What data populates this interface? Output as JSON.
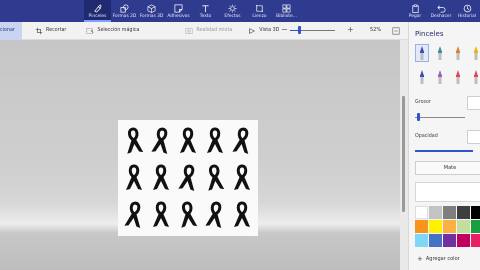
{
  "ribbon": {
    "tools": [
      {
        "name": "pinceles",
        "label": "Pinceles",
        "icon": "brush-icon",
        "active": true
      },
      {
        "name": "formas-2d",
        "label": "Formas 2D",
        "icon": "shapes-2d-icon"
      },
      {
        "name": "formas-3d",
        "label": "Formas 3D",
        "icon": "shapes-3d-icon"
      },
      {
        "name": "adhesivos",
        "label": "Adhesivos",
        "icon": "sticker-icon"
      },
      {
        "name": "texto",
        "label": "Texto",
        "icon": "text-icon"
      },
      {
        "name": "efectos",
        "label": "Efectos",
        "icon": "effects-icon"
      },
      {
        "name": "lienzo",
        "label": "Lienzo",
        "icon": "canvas-icon"
      },
      {
        "name": "biblioteca",
        "label": "Bibliote...",
        "icon": "library-icon"
      }
    ],
    "right_tools": [
      {
        "name": "pegar",
        "label": "Pegar",
        "icon": "paste-icon"
      },
      {
        "name": "deshacer",
        "label": "Deshacer",
        "icon": "undo-icon"
      },
      {
        "name": "historial",
        "label": "Historial",
        "icon": "history-icon"
      }
    ]
  },
  "toolbar2": {
    "seleccionar": "cionar",
    "recortar": "Recortar",
    "seleccion_magica": "Selección mágica",
    "realidad_mixta": "Realidad mixta",
    "vista_3d": "Vista 3D",
    "zoom_minus": "−",
    "zoom_plus": "+",
    "zoom_value": "52%",
    "zoom_fraction": 0.2
  },
  "panel": {
    "title": "Pinceles",
    "grosor_label": "Grosor",
    "opacidad_label": "Opacidad",
    "mate_label": "Mate",
    "add_color_label": "Agregar color",
    "brushes": [
      {
        "name": "marker-brush-icon",
        "color": "#3a4fb0",
        "selected": true
      },
      {
        "name": "calligraphy-pen-icon",
        "color": "#3a8f8f"
      },
      {
        "name": "oil-brush-icon",
        "color": "#d9822b"
      },
      {
        "name": "watercolor-brush-icon",
        "color": "#f0b400"
      },
      {
        "name": "pixel-pen-icon",
        "color": "#3a4fb0"
      },
      {
        "name": "pencil-icon",
        "color": "#9a5bc7"
      },
      {
        "name": "eraser-icon",
        "color": "#e0455a"
      },
      {
        "name": "crayon-icon",
        "color": "#e0455a"
      }
    ],
    "palette": [
      "#ffffff",
      "#c3c3c3",
      "#7f7f7f",
      "#3f3f3f",
      "#000000",
      "#f7941d",
      "#fff200",
      "#fbb040",
      "#c4df9b",
      "#1a9e3f",
      "#7fd6f7",
      "#4472c4",
      "#7030a0",
      "#c00060",
      "#e91e63"
    ]
  },
  "canvas": {
    "ribbon_color": "#111111"
  }
}
